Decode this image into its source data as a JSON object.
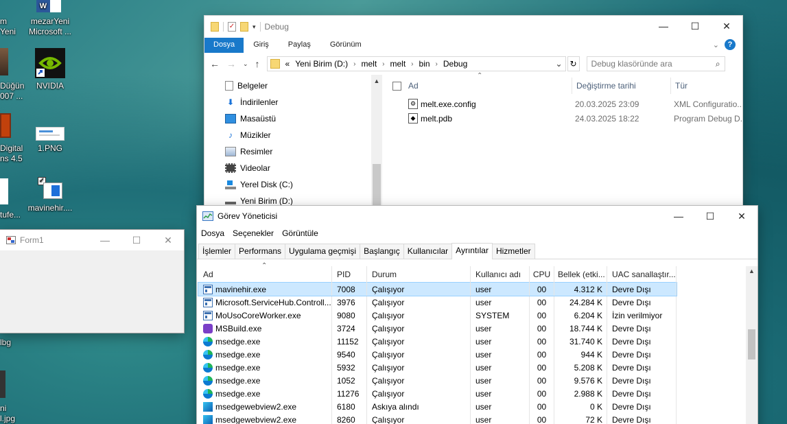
{
  "desktop": {
    "icons": [
      {
        "label_lines": [
          "m",
          "Yeni"
        ]
      },
      {
        "label_lines": [
          "mezarYeni",
          "Microsoft ..."
        ]
      },
      {
        "label_lines": [
          "Düğün",
          "007 ..."
        ]
      },
      {
        "label_lines": [
          "NVIDIA"
        ]
      },
      {
        "label_lines": [
          "Digital",
          "ns 4.5"
        ]
      },
      {
        "label_lines": [
          "1.PNG"
        ]
      },
      {
        "label_lines": [
          "tufe..."
        ]
      },
      {
        "label_lines": [
          "mavinehir...."
        ]
      },
      {
        "label_lines": [
          "lbg"
        ]
      },
      {
        "label_lines": [
          "ni",
          "l.jpg"
        ]
      }
    ]
  },
  "explorer": {
    "title": "Debug",
    "ribbon_tabs": [
      "Dosya",
      "Giriş",
      "Paylaş",
      "Görünüm"
    ],
    "breadcrumb": [
      "«",
      "Yeni Birim (D:)",
      "melt",
      "melt",
      "bin",
      "Debug"
    ],
    "search_placeholder": "Debug klasöründe ara",
    "nav_items": [
      "Belgeler",
      "İndirilenler",
      "Masaüstü",
      "Müzikler",
      "Resimler",
      "Videolar",
      "Yerel Disk (C:)",
      "Yeni Birim (D:)"
    ],
    "columns": [
      "Ad",
      "Değiştirme tarihi",
      "Tür"
    ],
    "files": [
      {
        "name": "melt.exe.config",
        "date": "20.03.2025 23:09",
        "type": "XML Configuratio..."
      },
      {
        "name": "melt.pdb",
        "date": "24.03.2025 18:22",
        "type": "Program Debug D..."
      }
    ]
  },
  "form1": {
    "title": "Form1"
  },
  "taskmgr": {
    "title": "Görev Yöneticisi",
    "menu": [
      "Dosya",
      "Seçenekler",
      "Görüntüle"
    ],
    "tabs": [
      "İşlemler",
      "Performans",
      "Uygulama geçmişi",
      "Başlangıç",
      "Kullanıcılar",
      "Ayrıntılar",
      "Hizmetler"
    ],
    "active_tab": "Ayrıntılar",
    "columns": [
      "Ad",
      "PID",
      "Durum",
      "Kullanıcı adı",
      "CPU",
      "Bellek (etki...",
      "UAC sanallaştır..."
    ],
    "rows": [
      {
        "icon": "window-app-icon",
        "name": "mavinehir.exe",
        "pid": "7008",
        "status": "Çalışıyor",
        "user": "user",
        "cpu": "00",
        "mem": "4.312 K",
        "uac": "Devre Dışı"
      },
      {
        "icon": "window-app-icon",
        "name": "Microsoft.ServiceHub.Controll...",
        "pid": "3976",
        "status": "Çalışıyor",
        "user": "user",
        "cpu": "00",
        "mem": "24.284 K",
        "uac": "Devre Dışı"
      },
      {
        "icon": "window-app-icon",
        "name": "MoUsoCoreWorker.exe",
        "pid": "9080",
        "status": "Çalışıyor",
        "user": "SYSTEM",
        "cpu": "00",
        "mem": "6.204 K",
        "uac": "İzin verilmiyor"
      },
      {
        "icon": "msbuild-icon",
        "name": "MSBuild.exe",
        "pid": "3724",
        "status": "Çalışıyor",
        "user": "user",
        "cpu": "00",
        "mem": "18.744 K",
        "uac": "Devre Dışı"
      },
      {
        "icon": "edge-icon",
        "name": "msedge.exe",
        "pid": "11152",
        "status": "Çalışıyor",
        "user": "user",
        "cpu": "00",
        "mem": "31.740 K",
        "uac": "Devre Dışı"
      },
      {
        "icon": "edge-icon",
        "name": "msedge.exe",
        "pid": "9540",
        "status": "Çalışıyor",
        "user": "user",
        "cpu": "00",
        "mem": "944 K",
        "uac": "Devre Dışı"
      },
      {
        "icon": "edge-icon",
        "name": "msedge.exe",
        "pid": "5932",
        "status": "Çalışıyor",
        "user": "user",
        "cpu": "00",
        "mem": "5.208 K",
        "uac": "Devre Dışı"
      },
      {
        "icon": "edge-icon",
        "name": "msedge.exe",
        "pid": "1052",
        "status": "Çalışıyor",
        "user": "user",
        "cpu": "00",
        "mem": "9.576 K",
        "uac": "Devre Dışı"
      },
      {
        "icon": "edge-icon",
        "name": "msedge.exe",
        "pid": "11276",
        "status": "Çalışıyor",
        "user": "user",
        "cpu": "00",
        "mem": "2.988 K",
        "uac": "Devre Dışı"
      },
      {
        "icon": "webview-icon",
        "name": "msedgewebview2.exe",
        "pid": "6180",
        "status": "Askıya alındı",
        "user": "user",
        "cpu": "00",
        "mem": "0 K",
        "uac": "Devre Dışı"
      },
      {
        "icon": "webview-icon",
        "name": "msedgewebview2.exe",
        "pid": "8260",
        "status": "Çalışıyor",
        "user": "user",
        "cpu": "00",
        "mem": "72 K",
        "uac": "Devre Dışı"
      }
    ]
  },
  "colors": {
    "accent": "#1979ca",
    "selection": "#cce8ff",
    "header_text": "#4c607a"
  }
}
